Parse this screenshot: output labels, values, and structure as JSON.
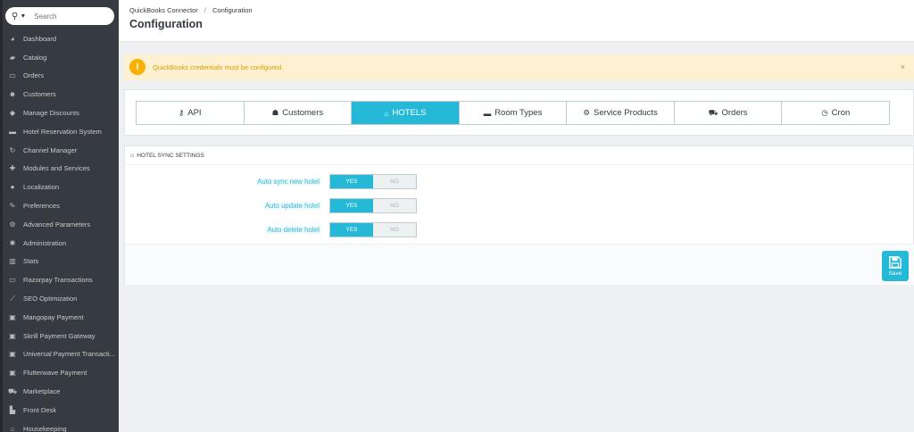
{
  "search": {
    "placeholder": "Search"
  },
  "sidebar": {
    "items": [
      {
        "label": "Dashboard",
        "icon": "dashboard-icon",
        "glyph": "◕"
      },
      {
        "label": "Catalog",
        "icon": "book-icon",
        "glyph": "▰"
      },
      {
        "label": "Orders",
        "icon": "credit-card-icon",
        "glyph": "▭"
      },
      {
        "label": "Customers",
        "icon": "users-icon",
        "glyph": "☻"
      },
      {
        "label": "Manage Discounts",
        "icon": "tag-icon",
        "glyph": "◆"
      },
      {
        "label": "Hotel Reservation System",
        "icon": "bed-icon",
        "glyph": "▬"
      },
      {
        "label": "Channel Manager",
        "icon": "refresh-icon",
        "glyph": "↻"
      },
      {
        "label": "Modules and Services",
        "icon": "puzzle-icon",
        "glyph": "✚"
      },
      {
        "label": "Localization",
        "icon": "globe-icon",
        "glyph": "●"
      },
      {
        "label": "Preferences",
        "icon": "wrench-icon",
        "glyph": "✎"
      },
      {
        "label": "Advanced Parameters",
        "icon": "cogs-icon",
        "glyph": "⚙"
      },
      {
        "label": "Administration",
        "icon": "gear-icon",
        "glyph": "✱"
      },
      {
        "label": "Stats",
        "icon": "bar-chart-icon",
        "glyph": "▥"
      },
      {
        "label": "Razorpay Transactions",
        "icon": "credit-card-icon",
        "glyph": "▭"
      },
      {
        "label": "SEO Optimization",
        "icon": "line-chart-icon",
        "glyph": "⟋"
      },
      {
        "label": "Mangopay Payment",
        "icon": "money-icon",
        "glyph": "▣"
      },
      {
        "label": "Skrill Payment Gateway",
        "icon": "money-icon",
        "glyph": "▣"
      },
      {
        "label": "Universal Payment Transacti...",
        "icon": "money-icon",
        "glyph": "▣"
      },
      {
        "label": "Flutterwave Payment",
        "icon": "money-icon",
        "glyph": "▣"
      },
      {
        "label": "Marketplace",
        "icon": "shopping-cart-icon",
        "glyph": "⛟"
      },
      {
        "label": "Front Desk",
        "icon": "building-icon",
        "glyph": "▙"
      },
      {
        "label": "Housekeeping",
        "icon": "home-icon",
        "glyph": "⌂"
      }
    ]
  },
  "breadcrumb": {
    "parent": "QuickBooks Connector",
    "separator": "/",
    "current": "Configuration"
  },
  "page": {
    "title": "Configuration"
  },
  "alert": {
    "message": "QuickBooks credentials must be configured.",
    "close": "×",
    "icon": "warning-icon"
  },
  "tabs": [
    {
      "label": "API",
      "icon": "key-icon",
      "glyph": "⚷",
      "active": false
    },
    {
      "label": "Customers",
      "icon": "user-icon",
      "glyph": "☗",
      "active": false
    },
    {
      "label": "HOTELS",
      "icon": "home-icon",
      "glyph": "⌂",
      "active": true
    },
    {
      "label": "Room Types",
      "icon": "bed-icon",
      "glyph": "▬",
      "active": false
    },
    {
      "label": "Service Products",
      "icon": "cogs-icon",
      "glyph": "⚙",
      "active": false
    },
    {
      "label": "Orders",
      "icon": "shopping-cart-icon",
      "glyph": "⛟",
      "active": false
    },
    {
      "label": "Cron",
      "icon": "clock-icon",
      "glyph": "◷",
      "active": false
    }
  ],
  "settings": {
    "title": "HOTEL SYNC SETTINGS",
    "rows": [
      {
        "label": "Auto sync new hotel",
        "yes": "YES",
        "no": "NO",
        "value": "YES"
      },
      {
        "label": "Auto update hotel",
        "yes": "YES",
        "no": "NO",
        "value": "YES"
      },
      {
        "label": "Auto delete hotel",
        "yes": "YES",
        "no": "NO",
        "value": "YES"
      }
    ],
    "save_label": "Save"
  },
  "colors": {
    "accent": "#25b9d7",
    "sidebar": "#363a41",
    "warning": "#fab000",
    "warning_bg": "#fdf1d1"
  }
}
